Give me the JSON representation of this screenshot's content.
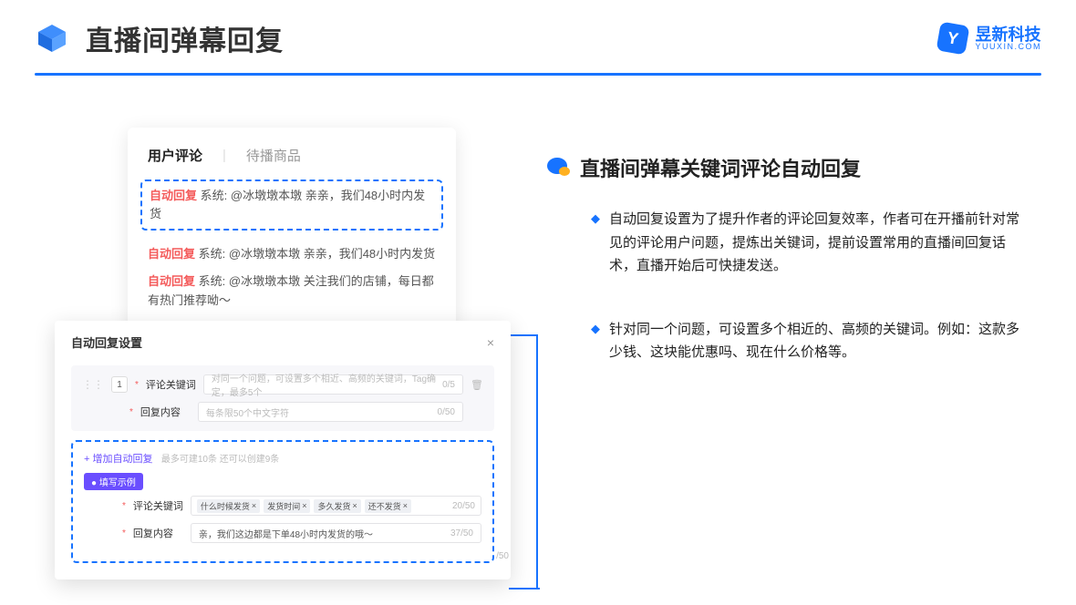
{
  "header": {
    "page_title": "直播间弹幕回复",
    "brand_name": "昱新科技",
    "brand_url": "YUUXIN.COM"
  },
  "comments_card": {
    "tab_active": "用户评论",
    "tab_inactive": "待播商品",
    "badge": "自动回复",
    "sys_prefix": "系统:",
    "highlight_text": "@冰墩墩本墩 亲亲，我们48小时内发货",
    "row2_text": "@冰墩墩本墩 亲亲，我们48小时内发货",
    "row3_text": "@冰墩墩本墩 关注我们的店铺，每日都有热门推荐呦～"
  },
  "settings": {
    "title": "自动回复设置",
    "close_label": "×",
    "index": "1",
    "kw_label": "评论关键词",
    "kw_placeholder": "对同一个问题，可设置多个相近、高频的关键词，Tag确定，最多5个",
    "kw_counter": "0/5",
    "content_label": "回复内容",
    "content_placeholder": "每条限50个中文字符",
    "content_counter": "0/50",
    "add_link": "+ 增加自动回复",
    "add_hint": "最多可建10条 还可以创建9条",
    "example_pill": "● 填写示例",
    "ex_kw_label": "评论关键词",
    "ex_tag1": "什么时候发货",
    "ex_tag2": "发货时间",
    "ex_tag3": "多久发货",
    "ex_tag4": "还不发货",
    "ex_kw_counter": "20/50",
    "ex_content_label": "回复内容",
    "ex_content_value": "亲，我们这边都是下单48小时内发货的哦～",
    "ex_content_counter": "37/50",
    "overflow_counter": "/50"
  },
  "right": {
    "heading": "直播间弹幕关键词评论自动回复",
    "b1": "自动回复设置为了提升作者的评论回复效率，作者可在开播前针对常见的评论用户问题，提炼出关键词，提前设置常用的直播间回复话术，直播开始后可快捷发送。",
    "b2": "针对同一个问题，可设置多个相近的、高频的关键词。例如：这款多少钱、这块能优惠吗、现在什么价格等。"
  }
}
